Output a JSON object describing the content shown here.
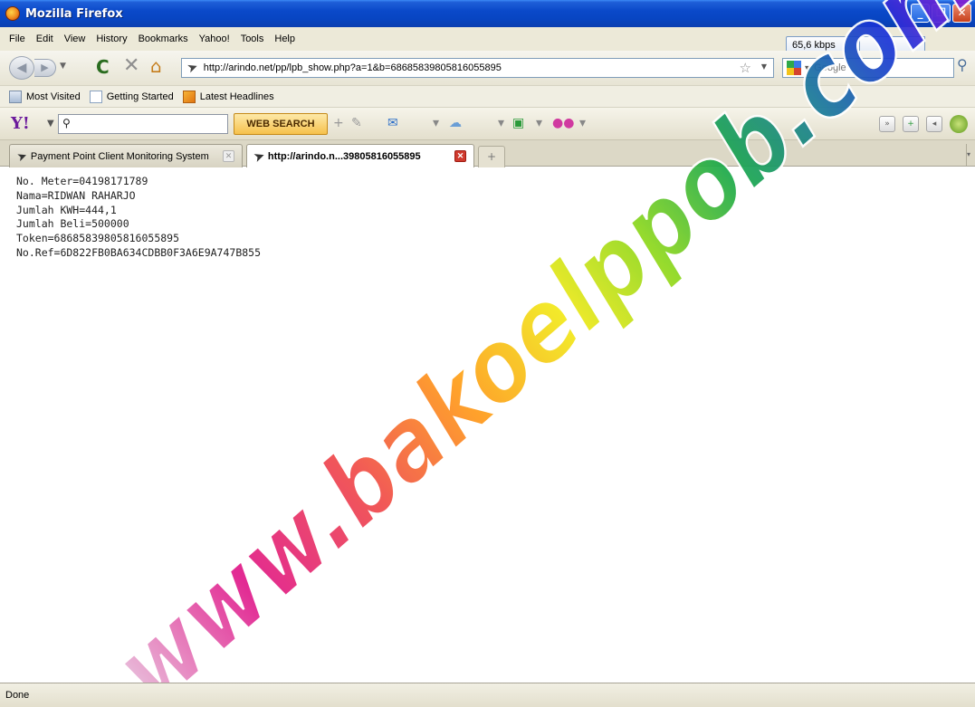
{
  "window": {
    "title": "Mozilla Firefox"
  },
  "menu": [
    "File",
    "Edit",
    "View",
    "History",
    "Bookmarks",
    "Yahoo!",
    "Tools",
    "Help"
  ],
  "network": {
    "speed": "65,6 kbps"
  },
  "nav": {
    "url": "http://arindo.net/pp/lpb_show.php?a=1&b=68685839805816055895",
    "search_placeholder": "Google"
  },
  "bookmarks": [
    "Most Visited",
    "Getting Started",
    "Latest Headlines"
  ],
  "yahoo": {
    "logo": "Y!",
    "search_button": "WEB SEARCH"
  },
  "tabs": [
    {
      "label": "Payment Point Client Monitoring System"
    },
    {
      "label": "http://arindo.n...39805816055895"
    }
  ],
  "content": {
    "lines": [
      "No. Meter=04198171789",
      "Nama=RIDWAN RAHARJO",
      "Jumlah KWH=444,1",
      "Jumlah Beli=500000",
      "Token=68685839805816055895",
      "No.Ref=6D822FB0BA634CDBB0F3A6E9A747B855"
    ]
  },
  "watermark": {
    "text": "www.bakoelppob.com"
  },
  "status": {
    "text": "Done"
  }
}
